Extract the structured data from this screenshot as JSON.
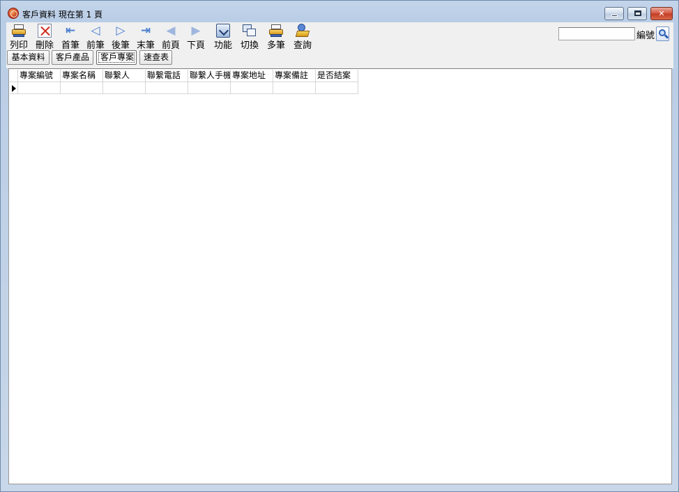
{
  "window": {
    "title": "客戶資料  現在第 1 頁"
  },
  "toolbar": {
    "buttons": [
      {
        "label": "列印",
        "icon": "print-icon"
      },
      {
        "label": "刪除",
        "icon": "delete-icon"
      },
      {
        "label": "首筆",
        "icon": "first-record-icon"
      },
      {
        "label": "前筆",
        "icon": "previous-record-icon"
      },
      {
        "label": "後筆",
        "icon": "next-record-icon"
      },
      {
        "label": "末筆",
        "icon": "last-record-icon"
      },
      {
        "label": "前頁",
        "icon": "previous-page-icon"
      },
      {
        "label": "下頁",
        "icon": "next-page-icon"
      },
      {
        "label": "功能",
        "icon": "function-icon"
      },
      {
        "label": "切換",
        "icon": "switch-icon"
      },
      {
        "label": "多筆",
        "icon": "multi-record-icon"
      },
      {
        "label": "查詢",
        "icon": "query-icon"
      }
    ],
    "search": {
      "value": "",
      "label": "編號"
    }
  },
  "tabs": [
    {
      "label": "基本資料"
    },
    {
      "label": "客戶產品"
    },
    {
      "label": "客戶專案",
      "active": true
    },
    {
      "label": "速查表"
    }
  ],
  "grid": {
    "columns": [
      "專案編號",
      "專案名稱",
      "聯繫人",
      "聯繫電話",
      "聯繫人手機",
      "專案地址",
      "專案備註",
      "是否結案"
    ],
    "rows": [
      [
        "",
        "",
        "",
        "",
        "",
        "",
        "",
        ""
      ]
    ]
  }
}
